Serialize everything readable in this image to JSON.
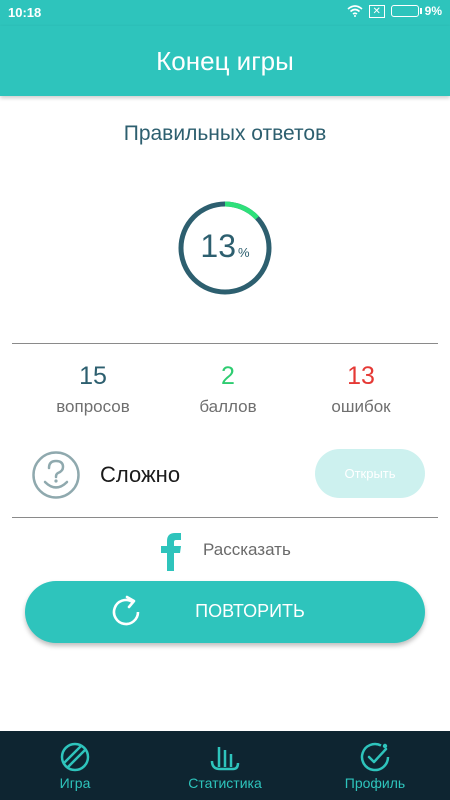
{
  "status": {
    "time": "10:18",
    "battery": "9%"
  },
  "header": {
    "title": "Конец игры"
  },
  "result": {
    "title": "Правильных ответов",
    "percent": "13",
    "percent_sign": "%",
    "progress": 0.13
  },
  "stats": [
    {
      "value": "15",
      "label": "вопросов",
      "color": "#2d5f6f"
    },
    {
      "value": "2",
      "label": "баллов",
      "color": "#2ecc71"
    },
    {
      "value": "13",
      "label": "ошибок",
      "color": "#e53935"
    }
  ],
  "difficulty": {
    "label": "Сложно",
    "button": "Открыть",
    "icon": "question-smile-icon"
  },
  "share": {
    "label": "Рассказать",
    "icon": "facebook-icon"
  },
  "repeat": {
    "label": "ПОВТОРИТЬ",
    "icon": "refresh-icon"
  },
  "nav": [
    {
      "label": "Игра",
      "icon": "game-icon"
    },
    {
      "label": "Статистика",
      "icon": "stats-icon"
    },
    {
      "label": "Профиль",
      "icon": "profile-icon"
    }
  ],
  "colors": {
    "accent": "#2ec4bc",
    "dark": "#2d5f6f",
    "nav_bg": "#0e2531"
  }
}
